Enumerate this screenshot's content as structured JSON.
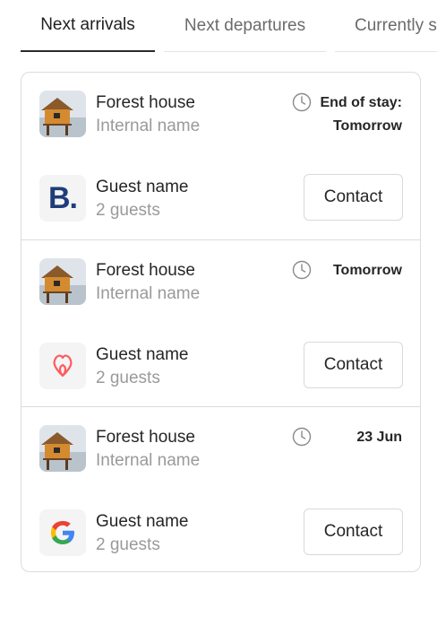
{
  "tabs": [
    {
      "label": "Next arrivals",
      "active": true
    },
    {
      "label": "Next departures",
      "active": false
    },
    {
      "label": "Currently staying",
      "active": false
    }
  ],
  "reservations": [
    {
      "property_name": "Forest house",
      "internal_name": "Internal name",
      "date_line_1": "End of stay:",
      "date_line_2": "Tomorrow",
      "guest_name": "Guest name",
      "guest_count": "2 guests",
      "channel_icon": "booking-com-icon",
      "contact_label": "Contact"
    },
    {
      "property_name": "Forest house",
      "internal_name": "Internal name",
      "date_line_1": "Tomorrow",
      "date_line_2": "",
      "guest_name": "Guest name",
      "guest_count": "2 guests",
      "channel_icon": "airbnb-icon",
      "contact_label": "Contact"
    },
    {
      "property_name": "Forest house",
      "internal_name": "Internal name",
      "date_line_1": "23 Jun",
      "date_line_2": "",
      "guest_name": "Guest name",
      "guest_count": "2 guests",
      "channel_icon": "google-icon",
      "contact_label": "Contact"
    }
  ],
  "colors": {
    "booking": "#1f3d7a",
    "airbnb": "#ff5a5f",
    "border": "#dcdcdc",
    "muted_text": "#9a9a9a"
  }
}
